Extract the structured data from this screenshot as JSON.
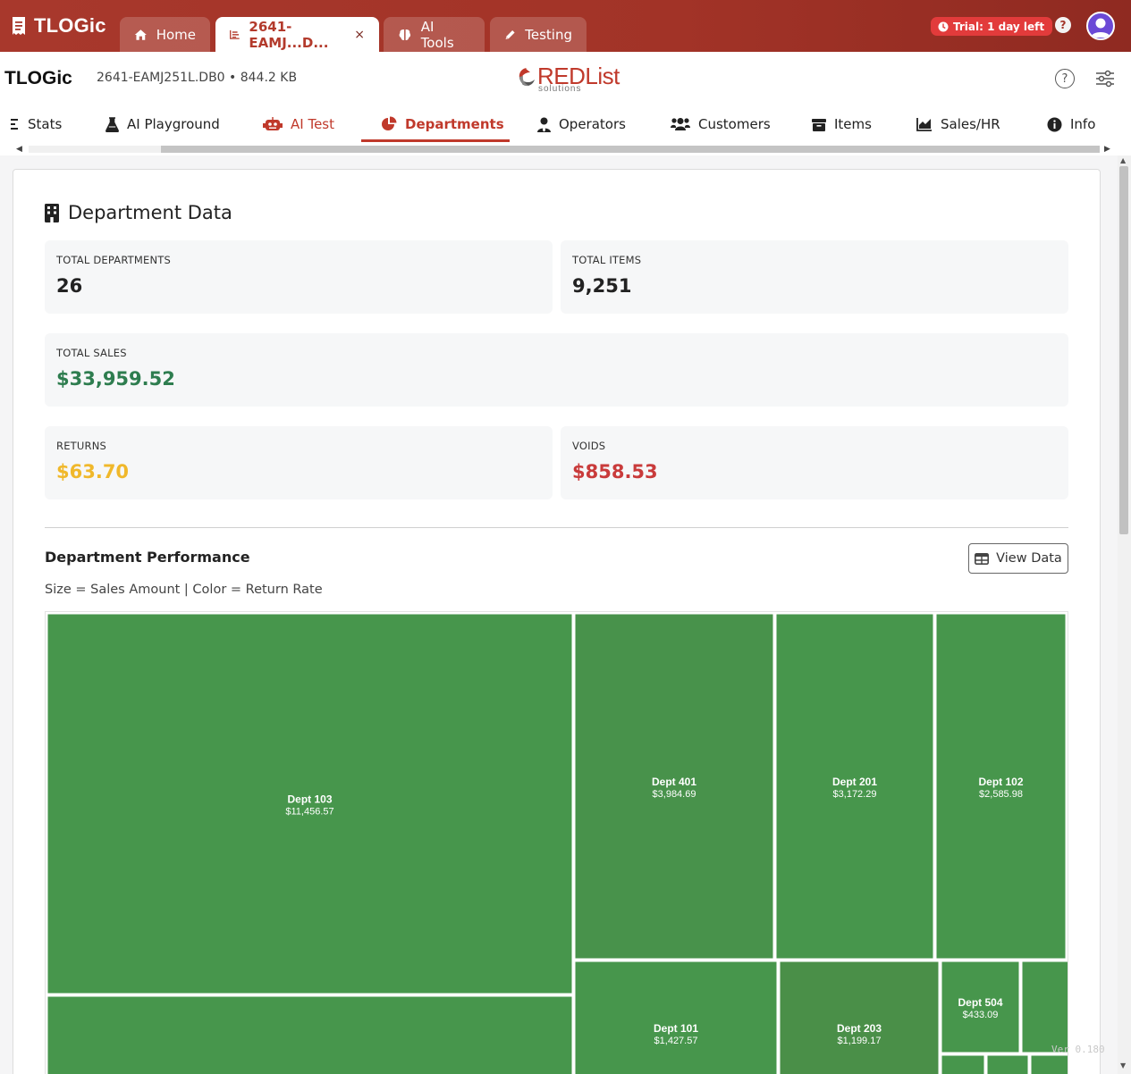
{
  "app": {
    "name": "TLOGic"
  },
  "tabs": [
    {
      "label": "Home",
      "icon": "home-icon"
    },
    {
      "label": "2641-EAMJ...D...",
      "icon": "chart-bar-icon",
      "close": "×",
      "active": true
    },
    {
      "label": "AI Tools",
      "icon": "brain-icon"
    },
    {
      "label": "Testing",
      "icon": "pencil-icon"
    }
  ],
  "trial": {
    "label": "Trial: 1 day left"
  },
  "header": {
    "title": "TLOGic",
    "file_info": "2641-EAMJ251L.DB0 • 844.2 KB",
    "logo_main": "REDList",
    "logo_sub": "solutions"
  },
  "nav": [
    {
      "label": "Stats"
    },
    {
      "label": "AI Playground"
    },
    {
      "label": "AI Test"
    },
    {
      "label": "Departments",
      "active": true
    },
    {
      "label": "Operators"
    },
    {
      "label": "Customers"
    },
    {
      "label": "Items"
    },
    {
      "label": "Sales/HR"
    },
    {
      "label": "Info"
    }
  ],
  "page": {
    "heading": "Department Data",
    "stats": {
      "total_departments": {
        "label": "TOTAL DEPARTMENTS",
        "value": "26"
      },
      "total_items": {
        "label": "TOTAL ITEMS",
        "value": "9,251"
      },
      "total_sales": {
        "label": "TOTAL SALES",
        "value": "$33,959.52"
      },
      "returns": {
        "label": "RETURNS",
        "value": "$63.70"
      },
      "voids": {
        "label": "VOIDS",
        "value": "$858.53"
      }
    },
    "performance": {
      "title": "Department Performance",
      "view_data_label": "View Data",
      "subtitle": "Size = Sales Amount | Color = Return Rate"
    },
    "version": "Ver 0.180"
  },
  "colors": {
    "brand": "#a8382c",
    "green": "#2e7d4f",
    "amber": "#f0b82b",
    "red": "#c93b3b",
    "treemap_green": "#47964c"
  },
  "chart_data": {
    "type": "treemap",
    "size_metric": "Sales Amount",
    "color_metric": "Return Rate",
    "items": [
      {
        "name": "Dept 103",
        "label": "$11,456.57",
        "value": 11456.57
      },
      {
        "name": "Dept 401",
        "label": "$3,984.69",
        "value": 3984.69
      },
      {
        "name": "Dept 201",
        "label": "$3,172.29",
        "value": 3172.29
      },
      {
        "name": "Dept 102",
        "label": "$2,585.98",
        "value": 2585.98
      },
      {
        "name": "Dept 101",
        "label": "$1,427.57",
        "value": 1427.57
      },
      {
        "name": "Dept 203",
        "label": "$1,199.17",
        "value": 1199.17
      },
      {
        "name": "Dept 504",
        "label": "$433.09",
        "value": 433.09
      }
    ]
  }
}
